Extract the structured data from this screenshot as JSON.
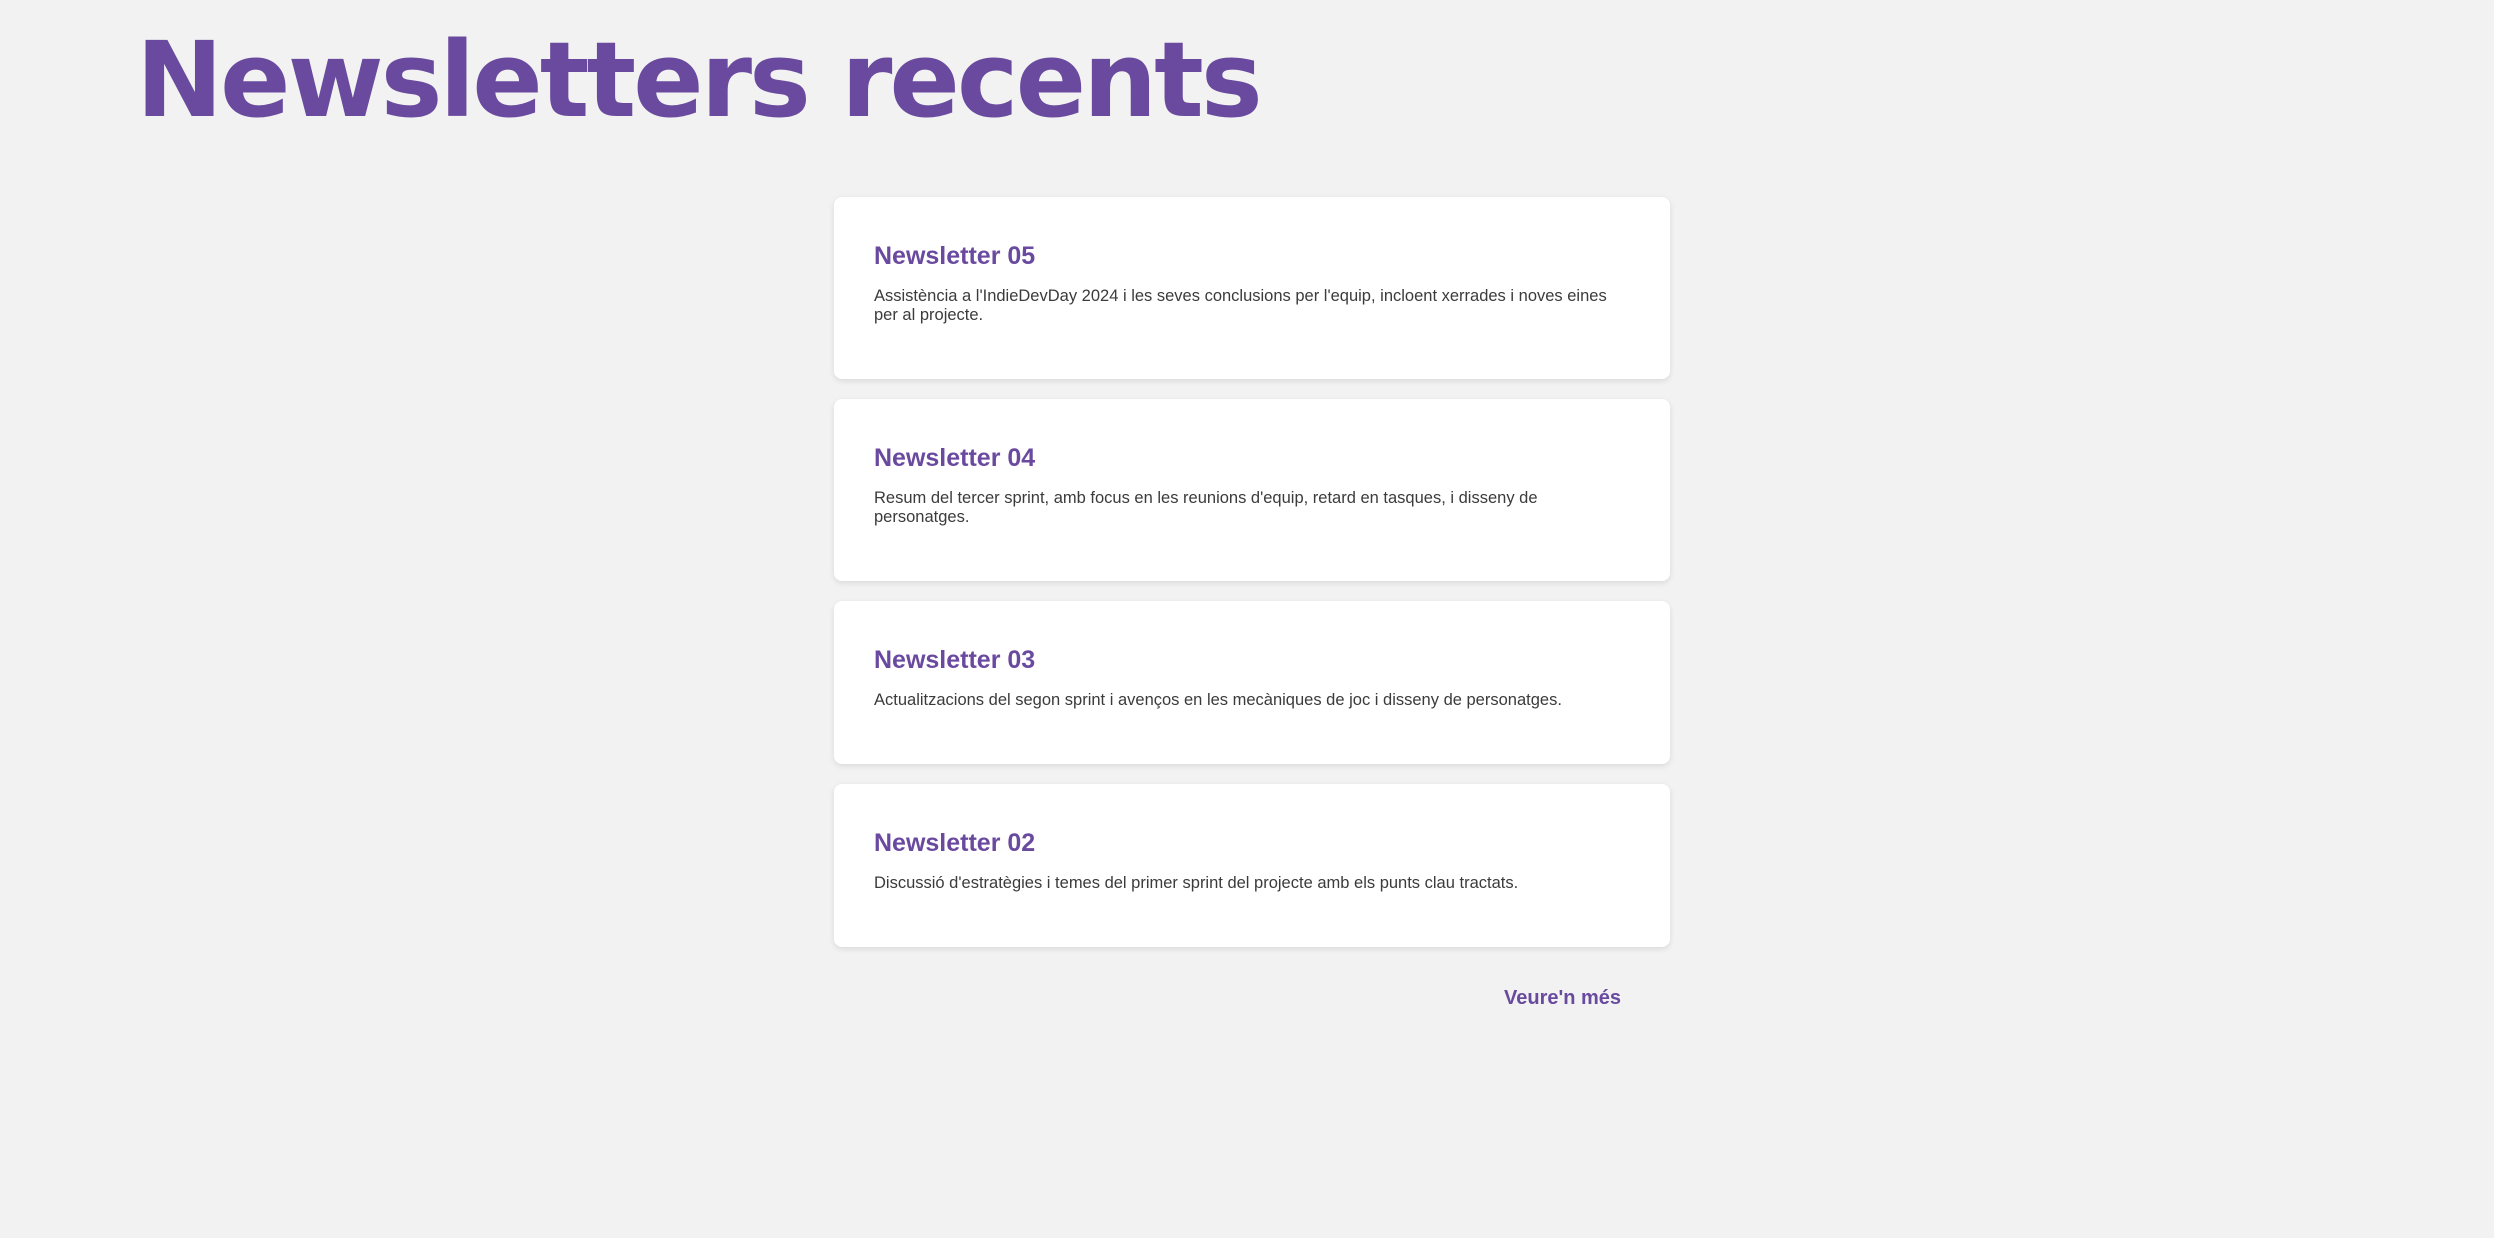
{
  "page": {
    "title": "Newsletters recents",
    "accent_color": "#6a4a9f",
    "background_color": "#f1f2f1"
  },
  "newsletters": [
    {
      "title": "Newsletter 05",
      "summary": "Assistència a l'IndieDevDay 2024 i les seves conclusions per l'equip, incloent xerrades i noves eines per al projecte."
    },
    {
      "title": "Newsletter 04",
      "summary": "Resum del tercer sprint, amb focus en les reunions d'equip, retard en tasques, i disseny de personatges."
    },
    {
      "title": "Newsletter 03",
      "summary": "Actualitzacions del segon sprint i avenços en les mecàniques de joc i disseny de personatges."
    },
    {
      "title": "Newsletter 02",
      "summary": "Discussió d'estratègies i temes del primer sprint del projecte amb els punts clau tractats."
    }
  ],
  "footer": {
    "more_label": "Veure'n més"
  }
}
